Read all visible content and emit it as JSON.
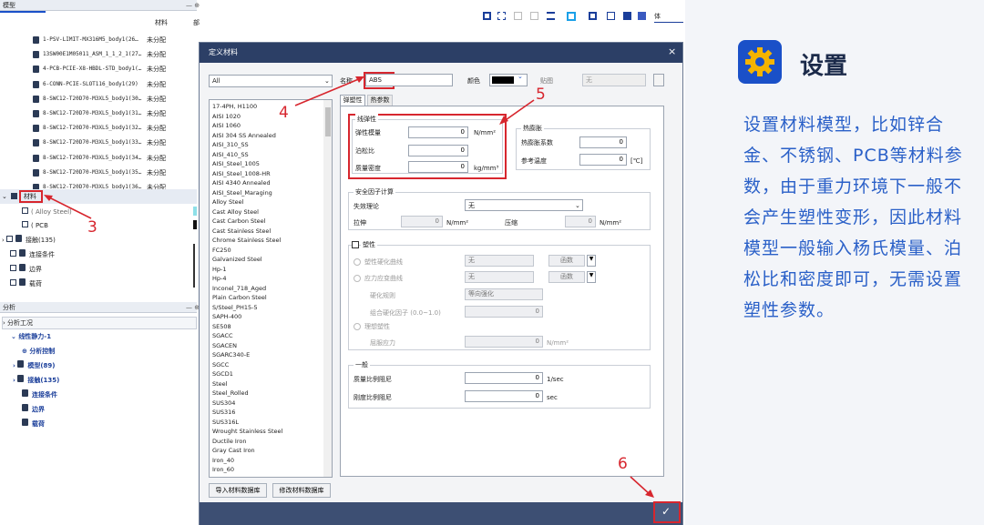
{
  "left": {
    "model_title": "模型",
    "col_material": "材料",
    "col_more": "部",
    "parts": [
      {
        "name": "1-PSV-LIMIT-MX316M5_body1(26…",
        "mat": "未分配"
      },
      {
        "name": "13SW00E1M05011_ASM_1_1_2_1(27…",
        "mat": "未分配"
      },
      {
        "name": "4-PCB-PCIE-X8-HBDL-STD_body1(…",
        "mat": "未分配"
      },
      {
        "name": "6-CONN-PCIE-SLOT116_body1(29)",
        "mat": "未分配"
      },
      {
        "name": "8-SWC12-T20D70-M3XL5_body1(30…",
        "mat": "未分配"
      },
      {
        "name": "8-SWC12-T20D70-M3XL5_body1(31…",
        "mat": "未分配"
      },
      {
        "name": "8-SWC12-T20D70-M3XL5_body1(32…",
        "mat": "未分配"
      },
      {
        "name": "8-SWC12-T20D70-M3XL5_body1(33…",
        "mat": "未分配"
      },
      {
        "name": "8-SWC12-T20D70-M3XL5_body1(34…",
        "mat": "未分配"
      },
      {
        "name": "8-SWC12-T20D70-M3XL5_body1(35…",
        "mat": "未分配"
      },
      {
        "name": "8-SWC12-T20D70-M3XL5_body1(36…",
        "mat": "未分配"
      }
    ],
    "material_node": "材料",
    "mat_children": [
      "( Alloy Steel)",
      "( PCB"
    ],
    "model_children": [
      "接触(135)",
      "连接条件",
      "边界",
      "载荷"
    ],
    "analysis_title": "分析",
    "analysis_root": "分析工况",
    "study": "线性静力-1",
    "study_children": [
      "分析控制",
      "模型(89)",
      "接触(135)",
      "连接条件",
      "边界",
      "载荷"
    ]
  },
  "dialog": {
    "title": "定义材料",
    "close": "×",
    "filter": "All",
    "name_label": "名称",
    "name_value": "ABS",
    "color_label": "颜色",
    "texture_label": "贴图",
    "texture_value": "无",
    "tabs": [
      "弹塑性",
      "热参数"
    ],
    "materials": [
      "17-4PH, H1100",
      "AISI 1020",
      "AISI 1060",
      "AISI 304 SS Annealed",
      "AISI_310_SS",
      "AISI_410_SS",
      "AISI_Steel_1005",
      "AISI_Steel_1008-HR",
      "AISI 4340 Annealed",
      "AISI_Steel_Maraging",
      "Alloy Steel",
      "Cast Alloy Steel",
      "Cast Carbon Steel",
      "Cast Stainless Steel",
      "Chrome Stainless Steel",
      "FC250",
      "Galvanized Steel",
      "Hp-1",
      "Hp-4",
      "Inconel_718_Aged",
      "Plain Carbon Steel",
      "S/Steel_PH15-5",
      "SAPH-400",
      "SE508",
      "SGACC",
      "SGACEN",
      "SGARC340-E",
      "SGCC",
      "SGCD1",
      "Steel",
      "Steel_Rolled",
      "SUS304",
      "SUS316",
      "SUS316L",
      "Wrought Stainless Steel",
      "Ductile Iron",
      "Gray Cast Iron",
      "Iron_40",
      "Iron_60"
    ],
    "btn_import": "导入材料数据库",
    "btn_edit": "修改材料数据库",
    "elastic": {
      "title": "线弹性",
      "youngs_label": "弹性模量",
      "youngs_value": "0",
      "youngs_unit": "N/mm²",
      "poisson_label": "泊松比",
      "poisson_value": "0",
      "density_label": "质量密度",
      "density_value": "0",
      "density_unit": "kg/mm³"
    },
    "thermal": {
      "title": "热膨胀",
      "coef_label": "热膨胀系数",
      "coef_value": "0",
      "ref_label": "参考温度",
      "ref_value": "0",
      "ref_unit": "[℃]"
    },
    "safety": {
      "title": "安全因子计算",
      "theory_label": "失效理论",
      "theory_value": "无",
      "tension_label": "拉伸",
      "tension_value": "0",
      "unit": "N/mm²",
      "compress_label": "压缩",
      "compress_value": "0"
    },
    "plastic": {
      "title": "塑性",
      "opt1": "塑性硬化曲线",
      "opt2": "应力应变曲线",
      "sel": "无",
      "func": "函数",
      "hard_label": "硬化规则",
      "hard_value": "等向强化",
      "comb_label": "组合硬化因子 (0.0~1.0)",
      "comb_value": "0",
      "opt3": "理想塑性",
      "yield_label": "屈服应力",
      "yield_value": "0",
      "yield_unit": "N/mm²"
    },
    "damping": {
      "title": "一般",
      "mass_label": "质量比例阻尼",
      "mass_value": "0",
      "mass_unit": "1/sec",
      "stiff_label": "刚度比例阻尼",
      "stiff_value": "0",
      "stiff_unit": "sec"
    },
    "ok": "✓"
  },
  "toolbar_label": "体",
  "annotations": [
    "3",
    "4",
    "5",
    "6"
  ],
  "panel": {
    "title": "设置",
    "text": "设置材料模型，比如锌合金、不锈钢、PCB等材料参数，由于重力环境下一般不会产生塑性变形，因此材料模型一般输入杨氏模量、泊松比和密度即可，无需设置塑性参数。"
  },
  "colors": {
    "accent": "#1a50c8",
    "annotation": "#d7262e",
    "dialog_bar": "#2c3f66",
    "panel_text": "#2a60c8"
  }
}
